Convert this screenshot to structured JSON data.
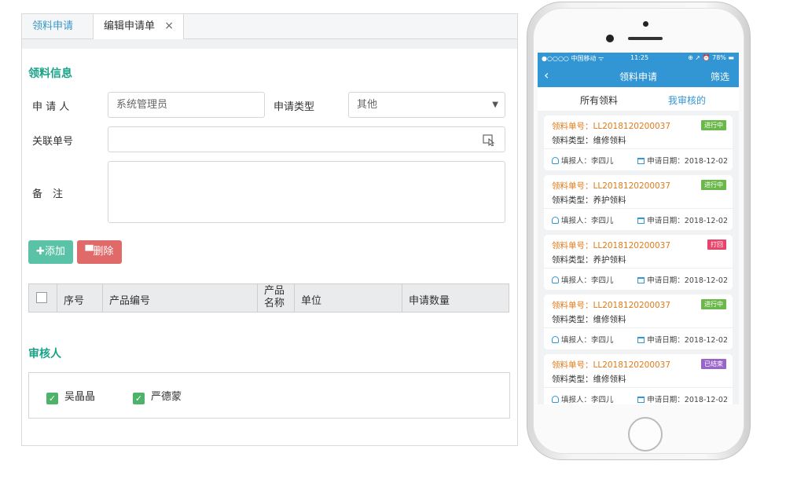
{
  "desktop": {
    "tabs": [
      {
        "label": "领料申请"
      },
      {
        "label": "编辑申请单",
        "close": "×"
      }
    ],
    "section_info": "领料信息",
    "form": {
      "applicant_label": "申 请 人",
      "applicant_value": "系统管理员",
      "type_label": "申请类型",
      "type_value": "其他",
      "type_arrow": "▼",
      "related_label": "关联单号",
      "related_value": "",
      "remark_label": "备　注",
      "remark_value": ""
    },
    "buttons": {
      "add": "✚添加",
      "delete": "▀删除"
    },
    "table_headers": [
      "序号",
      "产品编号",
      "产品名称",
      "单位",
      "申请数量"
    ],
    "section_reviewer": "审核人",
    "reviewers": [
      {
        "name": "吴晶晶",
        "checked": true
      },
      {
        "name": "严德蒙",
        "checked": true
      }
    ]
  },
  "mobile": {
    "status": {
      "carrier": "●○○○○ 中国移动 ᯤ",
      "time": "11:25",
      "right": "⊕ ➚ ⏰ 78% ▬"
    },
    "nav": {
      "back": "‹",
      "title": "领料申请",
      "filter": "筛选"
    },
    "segments": [
      "所有领料",
      "我审核的"
    ],
    "cards": [
      {
        "no": "领料单号：LL2018120200037",
        "type": "领料类型：维修领料",
        "status": "进行中",
        "status_color": "#6bb84a",
        "reporter": "填报人：李四儿",
        "date": "申请日期：2018-12-02"
      },
      {
        "no": "领料单号：LL2018120200037",
        "type": "领料类型：养护领料",
        "status": "进行中",
        "status_color": "#6bb84a",
        "reporter": "填报人：李四儿",
        "date": "申请日期：2018-12-02"
      },
      {
        "no": "领料单号：LL2018120200037",
        "type": "领料类型：养护领料",
        "status": "打回",
        "status_color": "#e8436b",
        "reporter": "填报人：李四儿",
        "date": "申请日期：2018-12-02"
      },
      {
        "no": "领料单号：LL2018120200037",
        "type": "领料类型：维修领料",
        "status": "进行中",
        "status_color": "#6bb84a",
        "reporter": "填报人：李四儿",
        "date": "申请日期：2018-12-02"
      },
      {
        "no": "领料单号：LL2018120200037",
        "type": "领料类型：维修领料",
        "status": "已结束",
        "status_color": "#9a65c9",
        "reporter": "填报人：李四儿",
        "date": "申请日期：2018-12-02"
      }
    ]
  }
}
